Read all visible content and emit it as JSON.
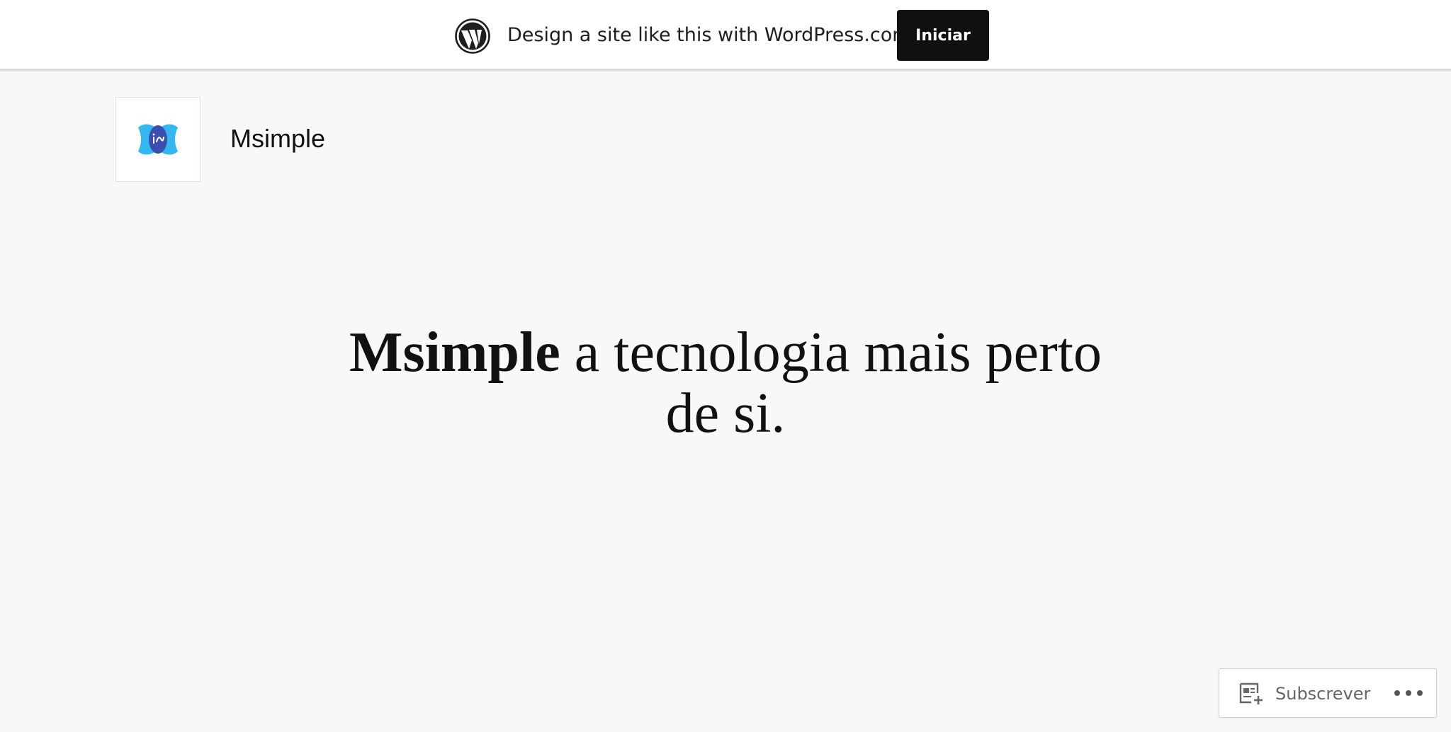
{
  "topbar": {
    "logo_icon": "wordpress-logo-icon",
    "promo_text": "Design a site like this with WordPress.com",
    "start_label": "Iniciar"
  },
  "site": {
    "logo_icon": "msimple-logo-icon",
    "title": "Msimple"
  },
  "hero": {
    "strong_text": "Msimple",
    "line1_rest": " a tecnologia mais perto",
    "line2": "de si."
  },
  "subscribe": {
    "icon": "subscribe-reader-icon",
    "label": "Subscrever",
    "more_icon": "ellipsis-icon"
  },
  "colors": {
    "background": "#f8f8f8",
    "topbar": "#ffffff",
    "button": "#101010",
    "logo_blue_light": "#36b6ee",
    "logo_blue_dark": "#3a4fb0"
  }
}
